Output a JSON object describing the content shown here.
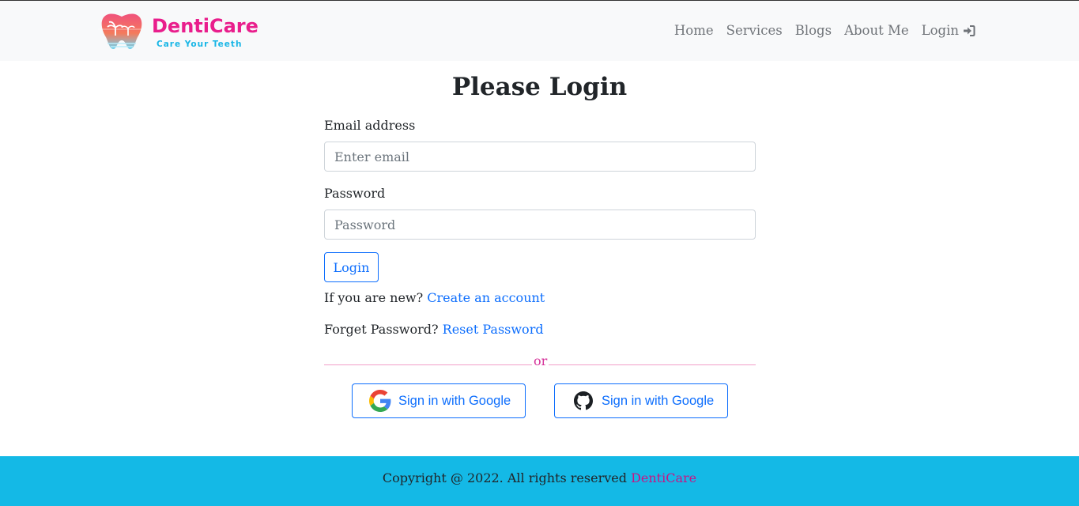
{
  "header": {
    "brand_name": "DentiCare",
    "brand_tagline": "Care Your Teeth",
    "nav": [
      {
        "label": "Home"
      },
      {
        "label": "Services"
      },
      {
        "label": "Blogs"
      },
      {
        "label": "About Me"
      },
      {
        "label": "Login",
        "icon": "sign-in-icon"
      }
    ]
  },
  "main": {
    "title": "Please Login",
    "email_label": "Email address",
    "email_placeholder": "Enter email",
    "email_value": "",
    "password_label": "Password",
    "password_placeholder": "Password",
    "password_value": "",
    "login_button": "Login",
    "new_user_text": "If you are new?",
    "create_account_link": "Create an account",
    "forget_text": "Forget Password?",
    "reset_link": "Reset Password",
    "divider_text": "or",
    "google_button": "Sign in with Google",
    "github_button": "Sign in with Google"
  },
  "footer": {
    "text": "Copyright @ 2022. All rights reserved",
    "brand": "DentiCare"
  },
  "colors": {
    "brand_pink": "#e91e8c",
    "brand_cyan": "#18b6e6",
    "primary": "#0d6efd",
    "footer_bg": "#14b9e6",
    "footer_brand": "#c71585"
  }
}
